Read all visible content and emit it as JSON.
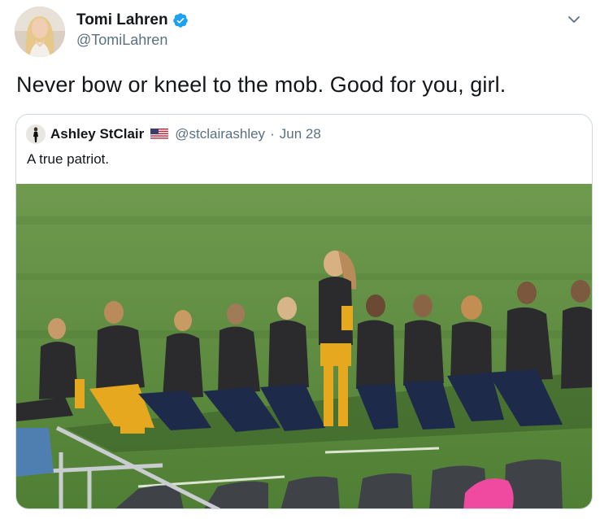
{
  "tweet": {
    "author": {
      "display_name": "Tomi Lahren",
      "handle": "@TomiLahren",
      "verified": true,
      "avatar_icon": "avatar-photo"
    },
    "text": "Never bow or kneel to the mob. Good for you, girl.",
    "menu_icon": "chevron-down-icon"
  },
  "quoted_tweet": {
    "author": {
      "display_name": "Ashley StClair",
      "flag_icon": "us-flag-icon",
      "handle": "@stclairashley",
      "separator": "·",
      "date": "Jun 28"
    },
    "text": "A true patriot.",
    "media": {
      "type": "photo",
      "description_icon": "soccer-team-photo"
    }
  },
  "colors": {
    "text_primary": "#14171a",
    "text_secondary": "#5b7083",
    "verified_blue": "#1da1f2",
    "border": "#cfd9de",
    "field_green": "#5f8f3e",
    "jersey": "#2b2b2e",
    "gold": "#e6a81e"
  }
}
